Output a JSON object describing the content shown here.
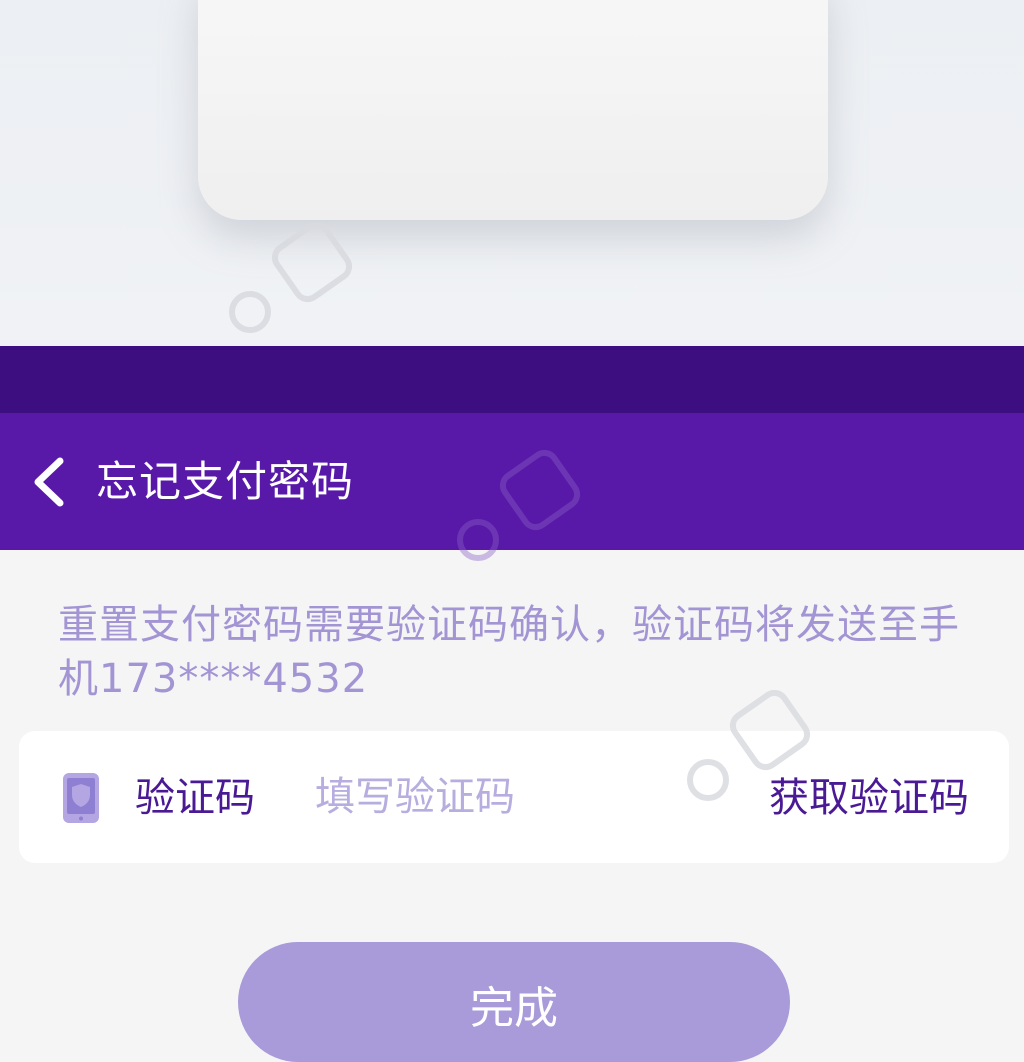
{
  "colors": {
    "status_bar": "#3d0e80",
    "nav_bar": "#5819a8",
    "accent_text": "#4a1a95",
    "hint_text": "#a394d4",
    "placeholder": "#b7addf",
    "button_bg": "#a99ad9",
    "page_bg": "#f5f5f6"
  },
  "nav": {
    "back_icon": "chevron-left-icon",
    "title": "忘记支付密码"
  },
  "hint": {
    "text": "重置支付密码需要验证码确认，验证码将发送至手机173****4532"
  },
  "verification": {
    "icon": "phone-shield-icon",
    "label": "验证码",
    "placeholder": "填写验证码",
    "value": "",
    "get_code_label": "获取验证码"
  },
  "actions": {
    "done_label": "完成"
  }
}
